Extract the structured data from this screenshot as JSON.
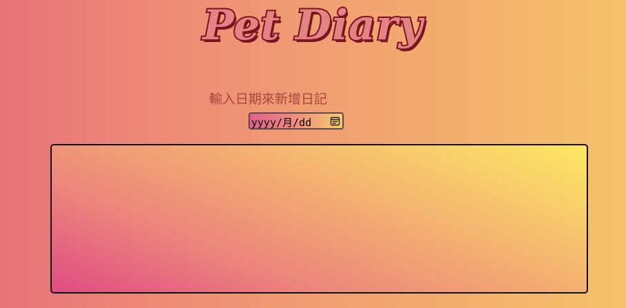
{
  "header": {
    "title": "Pet Diary"
  },
  "form": {
    "prompt_label": "輸入日期來新增日記",
    "date_input": {
      "placeholder_display": "yyyy/月/dd",
      "icon": "calendar-icon"
    }
  },
  "diary": {
    "entries": []
  },
  "colors": {
    "title_fill": "#e58283",
    "title_outline": "#7a1420",
    "prompt_text": "#a8453f",
    "background_left": "#e8737a",
    "background_right": "#f5c26a",
    "box_gradient_start": "#e04c82",
    "box_gradient_end": "#fde863"
  }
}
